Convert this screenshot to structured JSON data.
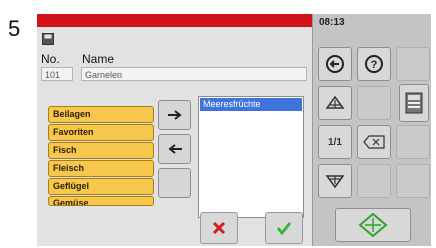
{
  "step_number": "5",
  "status": {
    "time": "08:13"
  },
  "item": {
    "no_label": "No.",
    "name_label": "Name",
    "number": "101",
    "name": "Garnelen"
  },
  "categories": [
    "Beilagen",
    "Favoriten",
    "Fisch",
    "Fleisch",
    "Geflügel",
    "Gemüse"
  ],
  "selected_list": [
    "Meeresfrüchte"
  ],
  "page_indicator": "1/1",
  "icons": {
    "cancel": "red-x-icon",
    "confirm": "green-check-icon",
    "back": "circle-left-arrow-icon",
    "help": "circle-question-icon",
    "up": "up-arrow-icon",
    "down": "down-arrow-icon",
    "backspace": "backspace-icon",
    "calculator": "calculator-icon",
    "start": "green-diamond-icon"
  },
  "colors": {
    "header_red": "#cf1318",
    "tab_yellow": "#f8c74e",
    "selection_blue": "#3f74dd",
    "cancel_red": "#d21e1e",
    "confirm_green": "#3bb43b"
  }
}
